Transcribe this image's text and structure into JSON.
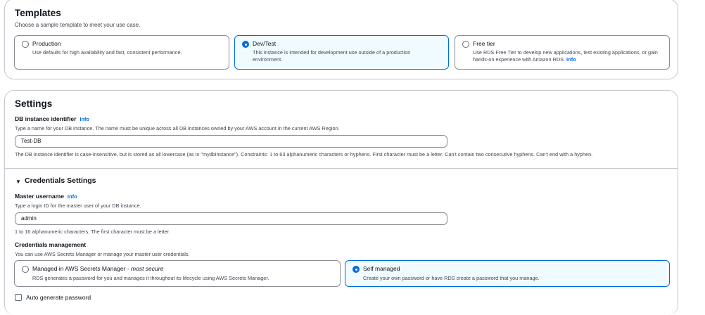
{
  "templates": {
    "title": "Templates",
    "description": "Choose a sample template to meet your use case.",
    "options": [
      {
        "title": "Production",
        "description": "Use defaults for high availability and fast, consistent performance.",
        "selected": false
      },
      {
        "title": "Dev/Test",
        "description": "This instance is intended for development use outside of a production environment.",
        "selected": true
      },
      {
        "title": "Free tier",
        "description": "Use RDS Free Tier to develop new applications, test existing applications, or gain hands-on experience with Amazon RDS.",
        "info": "Info",
        "selected": false
      }
    ]
  },
  "settings": {
    "title": "Settings",
    "db_identifier": {
      "label": "DB instance identifier",
      "info": "Info",
      "description": "Type a name for your DB instance. The name must be unique across all DB instances owned by your AWS account in the current AWS Region.",
      "value": "Test-DB",
      "constraint": "The DB instance identifier is case-insensitive, but is stored as all lowercase (as in \"mydbinstance\"). Constraints: 1 to 63 alphanumeric characters or hyphens. First character must be a letter. Can't contain two consecutive hyphens. Can't end with a hyphen."
    },
    "credentials": {
      "title": "Credentials Settings",
      "master_username": {
        "label": "Master username",
        "info": "Info",
        "description": "Type a login ID for the master user of your DB instance.",
        "value": "admin",
        "constraint": "1 to 16 alphanumeric characters. The first character must be a letter."
      },
      "management": {
        "label": "Credentials management",
        "description": "You can use AWS Secrets Manager or manage your master user credentials.",
        "options": [
          {
            "title": "Managed in AWS Secrets Manager - ",
            "title_emphasis": "most secure",
            "description": "RDS generates a password for you and manages it throughout its lifecycle using AWS Secrets Manager.",
            "selected": false
          },
          {
            "title": "Self managed",
            "description": "Create your own password or have RDS create a password that you manage.",
            "selected": true
          }
        ]
      },
      "auto_generate_label": "Auto generate password",
      "auto_generate_checked": false
    }
  },
  "colors": {
    "accent": "#006ce0",
    "selected_background": "#f0fbff",
    "border": "#c6c6cd"
  }
}
